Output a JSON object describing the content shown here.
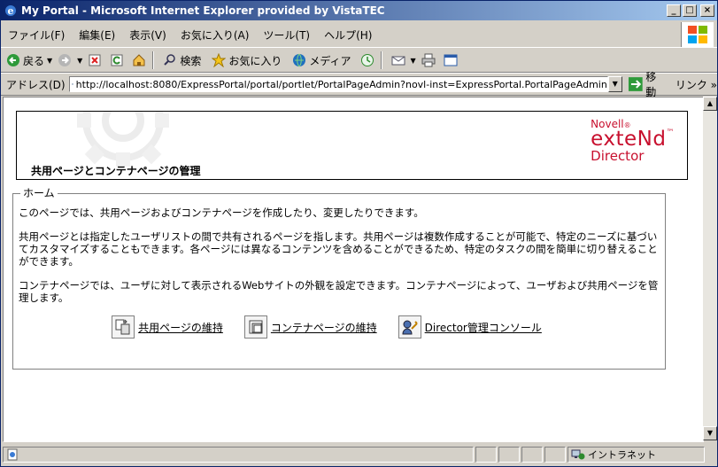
{
  "window": {
    "title": "My Portal - Microsoft Internet Explorer provided by VistaTEC"
  },
  "menu": [
    "ファイル(F)",
    "編集(E)",
    "表示(V)",
    "お気に入り(A)",
    "ツール(T)",
    "ヘルプ(H)"
  ],
  "toolbar": {
    "back": "戻る",
    "search": "検索",
    "favorites": "お気に入り",
    "media": "メディア"
  },
  "address": {
    "label": "アドレス(D)",
    "url": "http://localhost:8080/ExpressPortal/portal/portlet/PortalPageAdmin?novl-inst=ExpressPortal.PortalPageAdmin",
    "go": "移動",
    "links": "リンク"
  },
  "page": {
    "title": "共用ページとコンテナページの管理",
    "brand": {
      "novell": "Novell",
      "reg": "®",
      "extend": "exteNd",
      "tm": "™",
      "director": "Director"
    },
    "home_legend": "ホーム",
    "paragraphs": [
      "このページでは、共用ページおよびコンテナページを作成したり、変更したりできます。",
      "共用ページとは指定したユーザリストの間で共有されるページを指します。共用ページは複数作成することが可能で、特定のニーズに基づいてカスタマイズすることもできます。各ページには異なるコンテンツを含めることができるため、特定のタスクの間を簡単に切り替えることができます。",
      "コンテナページでは、ユーザに対して表示されるWebサイトの外観を設定できます。コンテナページによって、ユーザおよび共用ページを管理します。"
    ],
    "links": {
      "shared": "共用ページの維持",
      "container": "コンテナページの維持",
      "console": "Director管理コンソール"
    }
  },
  "status": {
    "zone": "イントラネット"
  },
  "colors": {
    "title_gradient_start": "#0a246a",
    "brand_red": "#c8102e",
    "chrome": "#d4d0c8"
  }
}
